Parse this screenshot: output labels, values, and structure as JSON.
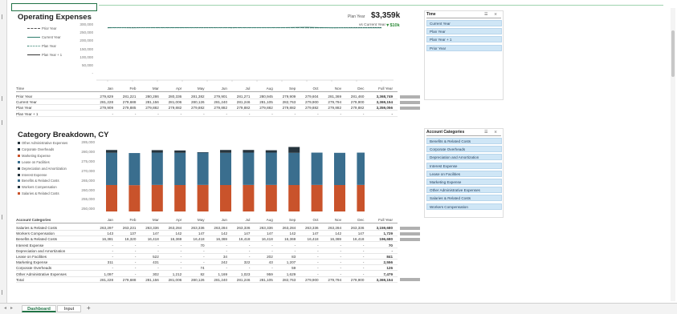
{
  "sheet": {
    "tabs": [
      "Dashboard",
      "Input"
    ],
    "add_sheet": "+"
  },
  "opex": {
    "title": "Operating Expenses",
    "plan_year_label": "Plan Year",
    "plan_year_value": "$3,359k",
    "vs_label": "vs Current Year",
    "vs_value": "▼$10k",
    "y_ticks": [
      "300,000",
      "250,000",
      "200,000",
      "150,000",
      "100,000",
      "50,000",
      "-"
    ],
    "legend": [
      "Prior Year",
      "Current Year",
      "Plan Year",
      "Plan Year + 1"
    ],
    "header": {
      "label": "Time",
      "months": [
        "Jan",
        "Feb",
        "Mar",
        "Apr",
        "May",
        "Jun",
        "Jul",
        "Aug",
        "Sep",
        "Oct",
        "Nov",
        "Dec"
      ],
      "fy": "Full Year"
    },
    "rows": [
      {
        "label": "Prior Year",
        "vals": [
          "279,829",
          "281,221",
          "280,286",
          "280,336",
          "281,382",
          "279,901",
          "281,271",
          "280,945",
          "279,909",
          "279,604",
          "281,369",
          "281,460"
        ],
        "fy": "3,368,749",
        "bar": 1.0
      },
      {
        "label": "Current Year",
        "vals": [
          "281,228",
          "279,688",
          "281,156",
          "281,006",
          "280,126",
          "281,240",
          "281,246",
          "281,105",
          "282,763",
          "279,900",
          "279,794",
          "279,900"
        ],
        "fy": "3,369,154",
        "bar": 1.0
      },
      {
        "label": "Plan Year",
        "vals": [
          "279,909",
          "279,885",
          "279,882",
          "279,882",
          "279,882",
          "279,882",
          "279,882",
          "279,882",
          "279,882",
          "279,882",
          "279,882",
          "279,882"
        ],
        "fy": "3,359,056",
        "bar": 0.99
      },
      {
        "label": "Plan Year + 1",
        "vals": [
          "-",
          "-",
          "-",
          "-",
          "-",
          "-",
          "-",
          "-",
          "-",
          "-",
          "-",
          "-"
        ],
        "fy": "-",
        "bar": 0
      }
    ]
  },
  "time_slicer": {
    "title": "Time",
    "items": [
      "Current Year",
      "Plan Year",
      "Plan Year + 1",
      "Prior Year"
    ]
  },
  "breakdown": {
    "title": "Category Breakdown, CY",
    "y_ticks": [
      "285,000",
      "280,000",
      "275,000",
      "270,000",
      "265,000",
      "260,000",
      "255,000",
      "250,000"
    ],
    "legend": [
      "Other Administrative Expenses",
      "Corporate Overheads",
      "Marketing Expense",
      "Lease on Facilities",
      "Depreciation and Amortization",
      "Interest Expense",
      "Benefits & Related Costs",
      "Workers Compensation",
      "Salaries & Related Costs"
    ],
    "header": {
      "label": "Account Categories",
      "months": [
        "Jan",
        "Feb",
        "Mar",
        "Apr",
        "May",
        "Jun",
        "Jul",
        "Aug",
        "Sep",
        "Oct",
        "Nov",
        "Dec"
      ],
      "fy": "Full Year"
    },
    "rows": [
      {
        "label": "Salaries & Related Costs",
        "vals": [
          "263,297",
          "263,231",
          "263,336",
          "263,284",
          "263,336",
          "263,284",
          "263,336",
          "263,336",
          "263,284",
          "263,336",
          "263,284",
          "263,336"
        ],
        "fy": "3,159,680",
        "bar": 1.0
      },
      {
        "label": "Workers Compensation",
        "vals": [
          "143",
          "137",
          "147",
          "142",
          "147",
          "142",
          "147",
          "147",
          "142",
          "147",
          "142",
          "147"
        ],
        "fy": "1,729",
        "bar": 1.0
      },
      {
        "label": "Benefits & Related Costs",
        "vals": [
          "16,381",
          "16,320",
          "16,418",
          "16,369",
          "16,418",
          "16,369",
          "16,418",
          "16,418",
          "16,369",
          "16,418",
          "16,369",
          "16,418"
        ],
        "fy": "196,680",
        "bar": 1.0
      },
      {
        "label": "Interest Expense",
        "vals": [
          "-",
          "-",
          "-",
          "-",
          "70",
          "-",
          "-",
          "-",
          "-",
          "-",
          "-",
          "-"
        ],
        "fy": "70",
        "bar": 0
      },
      {
        "label": "Depreciation and Amortization",
        "vals": [
          "-",
          "-",
          "-",
          "-",
          "-",
          "-",
          "-",
          "-",
          "-",
          "-",
          "-",
          "-"
        ],
        "fy": "-",
        "bar": 0
      },
      {
        "label": "Lease on Facilities",
        "vals": [
          "-",
          "-",
          "522",
          "-",
          "-",
          "34",
          "-",
          "202",
          "83",
          "-",
          "-",
          "-"
        ],
        "fy": "841",
        "bar": 0
      },
      {
        "label": "Marketing Expense",
        "vals": [
          "311",
          "-",
          "431",
          "-",
          "-",
          "242",
          "322",
          "43",
          "1,207",
          "-",
          "-",
          "-"
        ],
        "fy": "2,556",
        "bar": 0
      },
      {
        "label": "Corporate Overheads",
        "vals": [
          "-",
          "-",
          "-",
          "-",
          "74",
          "-",
          "-",
          "-",
          "59",
          "-",
          "-",
          "-"
        ],
        "fy": "126",
        "bar": 0
      },
      {
        "label": "Other Administrative Expenses",
        "vals": [
          "1,097",
          "-",
          "302",
          "1,212",
          "82",
          "1,169",
          "1,023",
          "959",
          "1,629",
          "-",
          "-",
          "-"
        ],
        "fy": "7,479",
        "bar": 0
      },
      {
        "label": "Total",
        "vals": [
          "281,228",
          "279,688",
          "281,156",
          "281,006",
          "280,126",
          "281,240",
          "281,246",
          "281,105",
          "282,763",
          "279,900",
          "279,794",
          "279,900"
        ],
        "fy": "3,369,154",
        "bar": 1.0
      }
    ]
  },
  "account_slicer": {
    "title": "Account Categories",
    "items": [
      "Benefits & Related Costs",
      "Corporate Overheads",
      "Depreciation and Amortization",
      "Interest Expense",
      "Lease on Facilities",
      "Marketing Expense",
      "Other Administrative Expenses",
      "Salaries & Related Costs",
      "Workers Compensation"
    ]
  },
  "chart_data": [
    {
      "type": "line",
      "title": "Operating Expenses",
      "categories": [
        "Jan",
        "Feb",
        "Mar",
        "Apr",
        "May",
        "Jun",
        "Jul",
        "Aug",
        "Sep",
        "Oct",
        "Nov",
        "Dec"
      ],
      "ylim": [
        0,
        300000
      ],
      "grid": false,
      "legend": "left",
      "series": [
        {
          "name": "Prior Year",
          "values": [
            279829,
            281221,
            280286,
            280336,
            281382,
            279901,
            281271,
            280945,
            279909,
            279604,
            281369,
            281460
          ]
        },
        {
          "name": "Current Year",
          "values": [
            281228,
            279688,
            281156,
            281006,
            280126,
            281240,
            281246,
            281105,
            282763,
            279900,
            279794,
            279900
          ]
        },
        {
          "name": "Plan Year",
          "values": [
            279909,
            279885,
            279882,
            279882,
            279882,
            279882,
            279882,
            279882,
            279882,
            279882,
            279882,
            279882
          ]
        },
        {
          "name": "Plan Year + 1",
          "values": []
        }
      ]
    },
    {
      "type": "bar",
      "title": "Category Breakdown, CY",
      "stacked": true,
      "categories": [
        "Jan",
        "Feb",
        "Mar",
        "Apr",
        "May",
        "Jun",
        "Jul",
        "Aug",
        "Sep",
        "Oct",
        "Nov",
        "Dec"
      ],
      "ylim": [
        250000,
        285000
      ],
      "legend": "left",
      "series": [
        {
          "name": "Salaries & Related Costs",
          "values": [
            263297,
            263231,
            263336,
            263284,
            263336,
            263284,
            263336,
            263336,
            263284,
            263336,
            263284,
            263336
          ]
        },
        {
          "name": "Workers Compensation",
          "values": [
            143,
            137,
            147,
            142,
            147,
            142,
            147,
            147,
            142,
            147,
            142,
            147
          ]
        },
        {
          "name": "Benefits & Related Costs",
          "values": [
            16381,
            16320,
            16418,
            16369,
            16418,
            16369,
            16418,
            16418,
            16369,
            16418,
            16369,
            16418
          ]
        },
        {
          "name": "Other",
          "values": [
            1408,
            0,
            1255,
            1212,
            226,
            1445,
            1345,
            1204,
            2978,
            0,
            0,
            0
          ]
        }
      ],
      "colors": {
        "salaries": "#c9532b",
        "benefits": "#3a6e8e",
        "other": "#26343d"
      }
    }
  ]
}
